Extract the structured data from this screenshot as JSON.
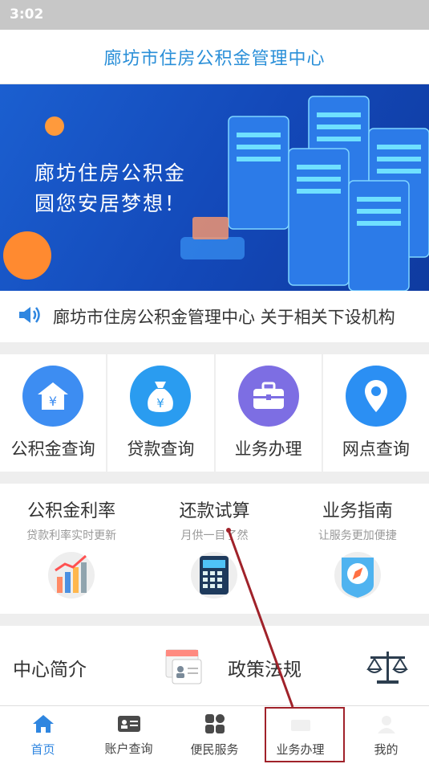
{
  "status": {
    "time": "3:02"
  },
  "header": {
    "title": "廊坊市住房公积金管理中心"
  },
  "banner": {
    "line1": "廊坊住房公积金",
    "line2": "圆您安居梦想！"
  },
  "notice": {
    "text": "廊坊市住房公积金管理中心 关于相关下设机构"
  },
  "quick": [
    {
      "label": "公积金查询",
      "icon": "house-yen-icon",
      "color": "#3d8df2"
    },
    {
      "label": "贷款查询",
      "icon": "money-bag-icon",
      "color": "#2a9cf0"
    },
    {
      "label": "业务办理",
      "icon": "briefcase-icon",
      "color": "#7d6ee3"
    },
    {
      "label": "网点查询",
      "icon": "location-pin-icon",
      "color": "#2b8ff3"
    }
  ],
  "tools": [
    {
      "title": "公积金利率",
      "subtitle": "贷款利率实时更新",
      "icon": "bar-chart-icon"
    },
    {
      "title": "还款试算",
      "subtitle": "月供一目了然",
      "icon": "calculator-icon"
    },
    {
      "title": "业务指南",
      "subtitle": "让服务更加便捷",
      "icon": "compass-icon"
    }
  ],
  "info": {
    "intro": "中心简介",
    "policy": "政策法规"
  },
  "tabs": [
    {
      "label": "首页",
      "icon": "home-icon"
    },
    {
      "label": "账户查询",
      "icon": "id-card-icon"
    },
    {
      "label": "便民服务",
      "icon": "grid-icon"
    },
    {
      "label": "业务办理",
      "icon": "service-icon"
    },
    {
      "label": "我的",
      "icon": "user-icon"
    }
  ]
}
